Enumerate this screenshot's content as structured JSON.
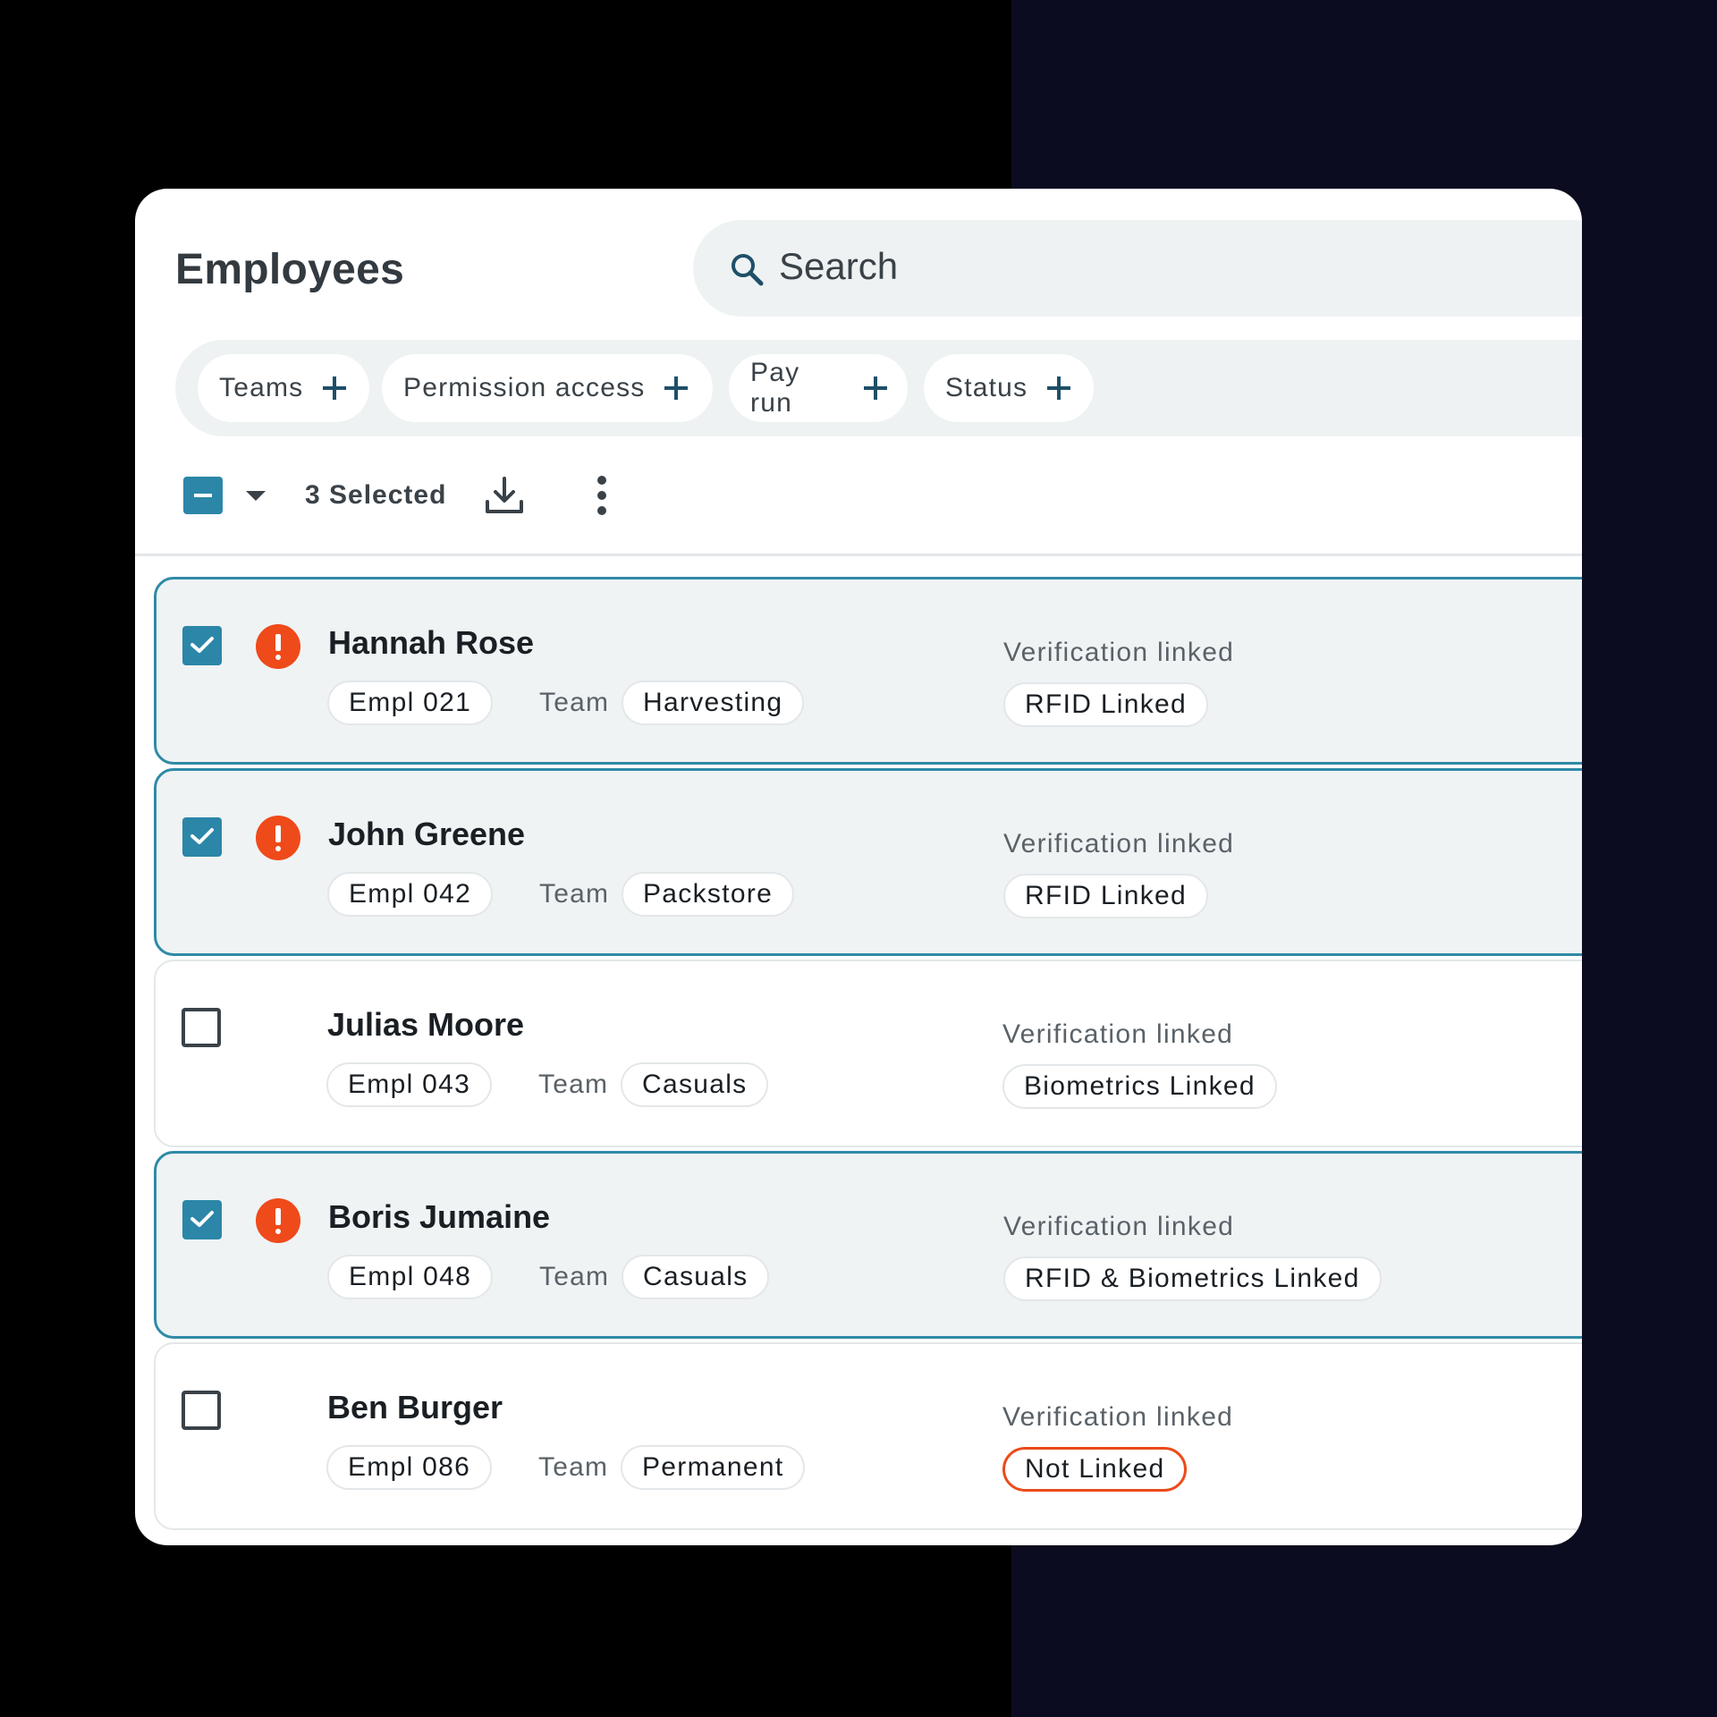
{
  "page": {
    "title": "Employees",
    "colors": {
      "accent": "#2b86a8",
      "selected_row_border": "#2f8aa6",
      "alert": "#ef4a1a",
      "warning_outline": "#ec4b1b"
    }
  },
  "search": {
    "placeholder": "Search",
    "icon": "search-icon"
  },
  "filters": [
    {
      "label": "Teams",
      "icon": "plus-icon"
    },
    {
      "label": "Permission access",
      "icon": "plus-icon"
    },
    {
      "label": "Pay run",
      "icon": "plus-icon"
    },
    {
      "label": "Status",
      "icon": "plus-icon"
    }
  ],
  "toolbar": {
    "selected_label": "3 Selected",
    "download_icon": "download-icon",
    "more_icon": "more-vertical-icon"
  },
  "employees": [
    {
      "name": "Hannah Rose",
      "empl_id": "Empl 021",
      "team_label": "Team",
      "team": "Harvesting",
      "verification_label": "Verification linked",
      "verification": "RFID Linked",
      "selected": true,
      "alert": true
    },
    {
      "name": "John Greene",
      "empl_id": "Empl 042",
      "team_label": "Team",
      "team": "Packstore",
      "verification_label": "Verification linked",
      "verification": "RFID Linked",
      "selected": true,
      "alert": true
    },
    {
      "name": "Julias Moore",
      "empl_id": "Empl 043",
      "team_label": "Team",
      "team": "Casuals",
      "verification_label": "Verification linked",
      "verification": "Biometrics Linked",
      "selected": false,
      "alert": false
    },
    {
      "name": "Boris Jumaine",
      "empl_id": "Empl 048",
      "team_label": "Team",
      "team": "Casuals",
      "verification_label": "Verification linked",
      "verification": "RFID & Biometrics Linked",
      "selected": true,
      "alert": true
    },
    {
      "name": "Ben Burger",
      "empl_id": "Empl 086",
      "team_label": "Team",
      "team": "Permanent",
      "verification_label": "Verification linked",
      "verification": "Not Linked",
      "selected": false,
      "alert": false
    }
  ]
}
